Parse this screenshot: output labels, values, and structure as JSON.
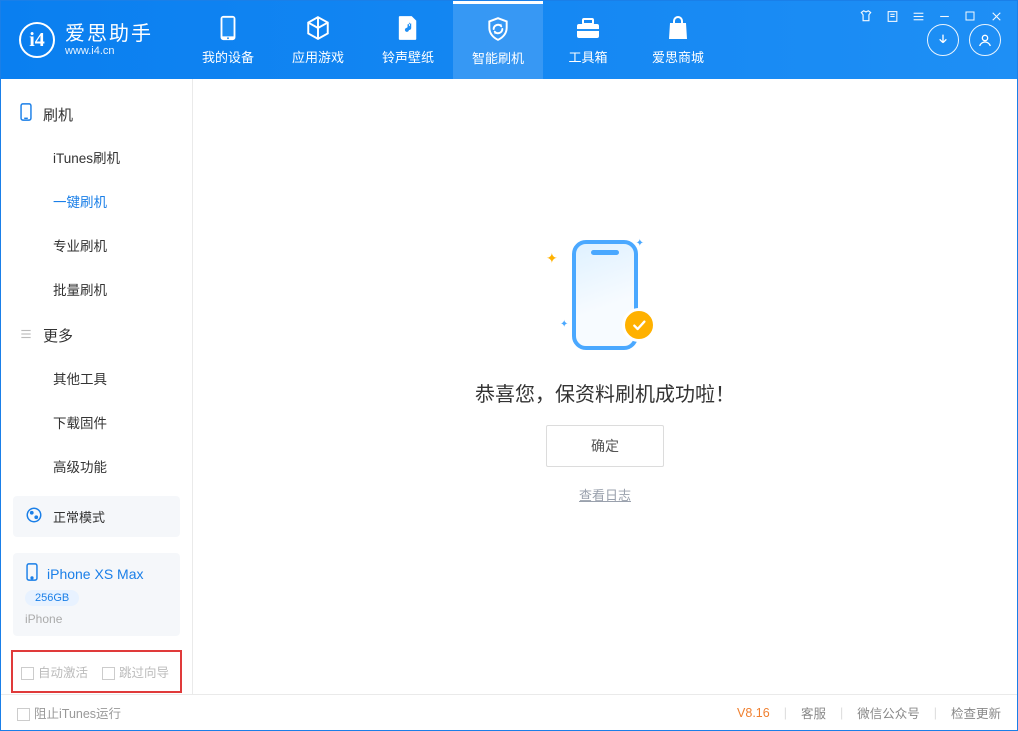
{
  "app": {
    "name": "爱思助手",
    "url": "www.i4.cn"
  },
  "nav": {
    "items": [
      {
        "label": "我的设备"
      },
      {
        "label": "应用游戏"
      },
      {
        "label": "铃声壁纸"
      },
      {
        "label": "智能刷机"
      },
      {
        "label": "工具箱"
      },
      {
        "label": "爱思商城"
      }
    ]
  },
  "sidebar": {
    "group1_title": "刷机",
    "group1_items": [
      "iTunes刷机",
      "一键刷机",
      "专业刷机",
      "批量刷机"
    ],
    "group2_title": "更多",
    "group2_items": [
      "其他工具",
      "下载固件",
      "高级功能"
    ]
  },
  "mode": {
    "label": "正常模式"
  },
  "device": {
    "name": "iPhone XS Max",
    "storage": "256GB",
    "type": "iPhone"
  },
  "options": {
    "auto_activate": "自动激活",
    "skip_guide": "跳过向导"
  },
  "main": {
    "message": "恭喜您，保资料刷机成功啦！",
    "ok": "确定",
    "view_log": "查看日志"
  },
  "status": {
    "block_itunes": "阻止iTunes运行",
    "version": "V8.16",
    "links": [
      "客服",
      "微信公众号",
      "检查更新"
    ]
  }
}
